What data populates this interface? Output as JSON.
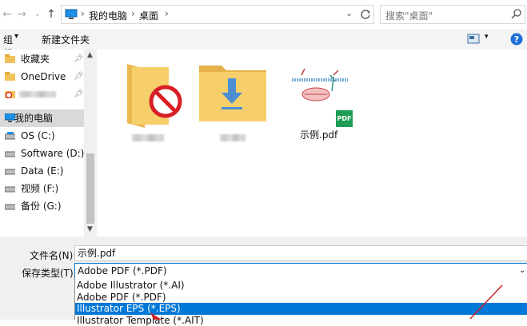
{
  "address": {
    "crumbs": [
      "我的电脑",
      "桌面"
    ],
    "search_placeholder": "搜索\"桌面\""
  },
  "toolbar": {
    "organize_label": "组织",
    "new_folder_label": "新建文件夹"
  },
  "sidebar": {
    "items": [
      {
        "label": "收藏夹",
        "icon": "folder-icon"
      },
      {
        "label": "OneDrive",
        "icon": "folder-icon"
      },
      {
        "label": "",
        "icon": "folder-icon",
        "blurred": true
      },
      {
        "label": "我的电脑",
        "icon": "computer-icon",
        "selected": true
      },
      {
        "label": "OS (C:)",
        "icon": "drive-icon"
      },
      {
        "label": "Software (D:)",
        "icon": "drive-icon"
      },
      {
        "label": "Data (E:)",
        "icon": "drive-icon"
      },
      {
        "label": "视频 (F:)",
        "icon": "drive-icon"
      },
      {
        "label": "备份 (G:)",
        "icon": "drive-icon"
      }
    ]
  },
  "files": [
    {
      "name": "",
      "icon": "restricted-folder-icon",
      "blurred": true
    },
    {
      "name": "",
      "icon": "downloads-folder-icon",
      "blurred": true
    },
    {
      "name": "示例.pdf",
      "icon": "pdf-file-icon",
      "badge": "PDF"
    }
  ],
  "form": {
    "filename_label": "文件名(N):",
    "filename_value": "示例.pdf",
    "type_label": "保存类型(T):",
    "type_value": "Adobe PDF (*.PDF)"
  },
  "dropdown": {
    "options": [
      "Adobe Illustrator (*.AI)",
      "Adobe PDF (*.PDF)",
      "Illustrator EPS (*.EPS)",
      "Illustrator Template (*.AIT)"
    ],
    "highlighted_index": 2
  },
  "colors": {
    "accent": "#0078d7",
    "folder": "#f5c85a",
    "pdf_badge": "#1f9d55",
    "annotation_arrow": "#cc2222"
  }
}
